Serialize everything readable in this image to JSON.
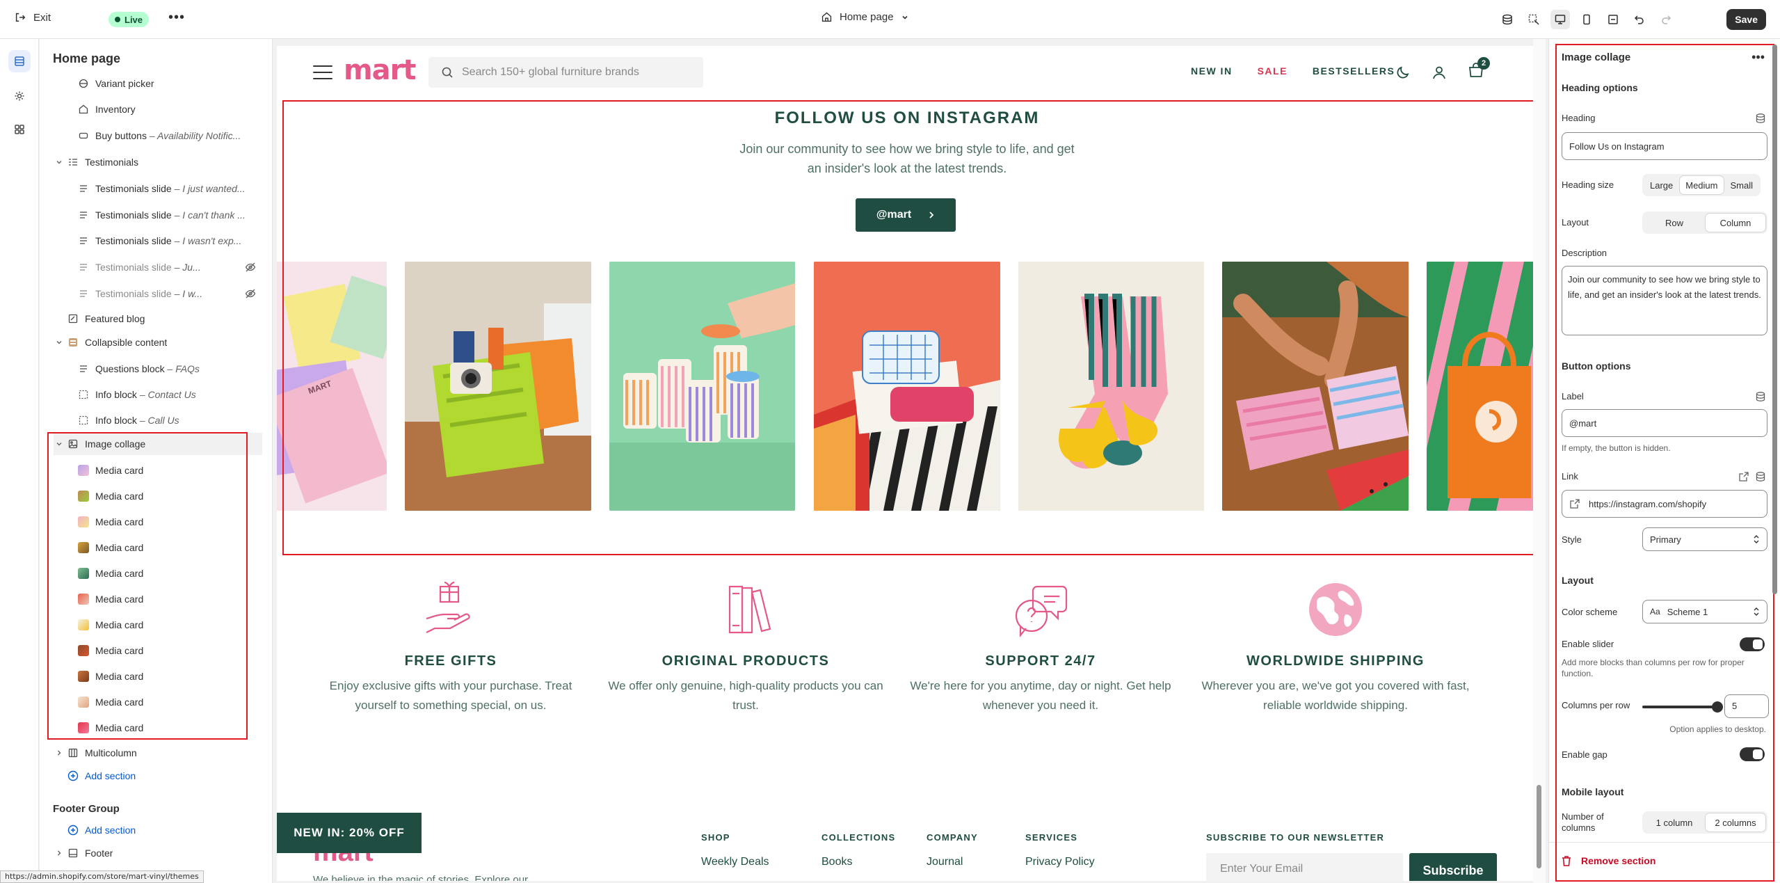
{
  "topbar": {
    "exit_label": "Exit",
    "status_badge": "Live",
    "page_selector": "Home page",
    "save_label": "Save"
  },
  "sidebar": {
    "title": "Home page",
    "items": [
      {
        "label": "Variant picker",
        "sub": ""
      },
      {
        "label": "Inventory",
        "sub": ""
      },
      {
        "label": "Buy buttons",
        "sub": "Availability Notific..."
      },
      {
        "label": "Testimonials",
        "sub": ""
      },
      {
        "label": "Testimonials slide",
        "sub": "I just wanted..."
      },
      {
        "label": "Testimonials slide",
        "sub": "I can't thank ..."
      },
      {
        "label": "Testimonials slide",
        "sub": "I wasn't exp..."
      },
      {
        "label": "Testimonials slide",
        "sub": "Ju..."
      },
      {
        "label": "Testimonials slide",
        "sub": "I w..."
      },
      {
        "label": "Featured blog",
        "sub": ""
      },
      {
        "label": "Collapsible content",
        "sub": ""
      },
      {
        "label": "Questions block",
        "sub": "FAQs"
      },
      {
        "label": "Info block",
        "sub": "Contact Us"
      },
      {
        "label": "Info block",
        "sub": "Call Us"
      },
      {
        "label": "Image collage",
        "sub": ""
      }
    ],
    "media_cards": [
      "Media card",
      "Media card",
      "Media card",
      "Media card",
      "Media card",
      "Media card",
      "Media card",
      "Media card",
      "Media card",
      "Media card",
      "Media card"
    ],
    "multicolumn": "Multicolumn",
    "add_section": "Add section",
    "footer_group": "Footer Group",
    "footer_add_section": "Add section",
    "footer": "Footer"
  },
  "store": {
    "logo": "mart",
    "search_placeholder": "Search 150+ global furniture brands",
    "nav": [
      "NEW IN",
      "SALE",
      "BESTSELLERS"
    ],
    "cart_count": "2",
    "instagram": {
      "title": "FOLLOW US ON INSTAGRAM",
      "description": "Join our community to see how we bring style to life, and get an insider's look at the latest trends.",
      "button_label": "@mart"
    },
    "features": [
      {
        "title": "FREE GIFTS",
        "text": "Enjoy exclusive gifts with your purchase. Treat yourself to something special, on us."
      },
      {
        "title": "ORIGINAL PRODUCTS",
        "text": "We offer only genuine, high-quality products you can trust."
      },
      {
        "title": "SUPPORT 24/7",
        "text": "We're here for you anytime, day or night. Get help whenever you need it."
      },
      {
        "title": "WORLDWIDE SHIPPING",
        "text": "Wherever you are, we've got you covered with fast, reliable worldwide shipping."
      }
    ],
    "promo": "NEW IN: 20% OFF",
    "footer": {
      "tagline": "We believe in the magic of stories. Explore our",
      "cols": [
        {
          "heading": "SHOP",
          "item": "Weekly Deals"
        },
        {
          "heading": "COLLECTIONS",
          "item": "Books"
        },
        {
          "heading": "COMPANY",
          "item": "Journal"
        },
        {
          "heading": "SERVICES",
          "item": "Privacy Policy"
        }
      ],
      "newsletter_heading": "SUBSCRIBE TO OUR NEWSLETTER",
      "email_placeholder": "Enter Your Email",
      "subscribe": "Subscribe"
    }
  },
  "status_url": "https://admin.shopify.com/store/mart-vinyl/themes",
  "settings": {
    "title": "Image collage",
    "heading_options": "Heading options",
    "heading_label": "Heading",
    "heading_value": "Follow Us on Instagram",
    "heading_size_label": "Heading size",
    "heading_sizes": [
      "Large",
      "Medium",
      "Small"
    ],
    "layout_label": "Layout",
    "layout_options": [
      "Row",
      "Column"
    ],
    "description_label": "Description",
    "description_value": "Join our community to see how we bring style to life, and get an insider's look at the latest trends.",
    "button_options": "Button options",
    "label_label": "Label",
    "label_value": "@mart",
    "label_help": "If empty, the button is hidden.",
    "link_label": "Link",
    "link_value": "https://instagram.com/shopify",
    "style_label": "Style",
    "style_value": "Primary",
    "layout_heading": "Layout",
    "color_scheme_label": "Color scheme",
    "color_scheme_value": "Scheme 1",
    "enable_slider_label": "Enable slider",
    "enable_slider_help": "Add more blocks than columns per row for proper function.",
    "columns_label": "Columns per row",
    "columns_value": "5",
    "columns_help": "Option applies to desktop.",
    "enable_gap_label": "Enable gap",
    "mobile_layout": "Mobile layout",
    "num_columns_label": "Number of columns",
    "num_columns_options": [
      "1 column",
      "2 columns"
    ],
    "remove_section": "Remove section"
  },
  "colors": {
    "brand_green": "#1f4d42",
    "brand_pink": "#e4588a",
    "sale_red": "#d6364f",
    "selection_red": "#e11b22",
    "live_green": "#b4fed2"
  }
}
